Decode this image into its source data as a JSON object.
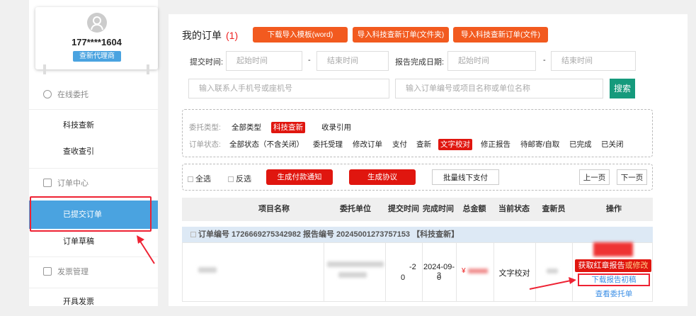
{
  "user": {
    "phone": "177****1604",
    "role": "查新代理商"
  },
  "sidebar": {
    "online": "在线委托",
    "online_items": [
      "科技查新",
      "查收查引"
    ],
    "order_center": "订单中心",
    "submitted": "已提交订单",
    "draft": "订单草稿",
    "invoice": "发票管理",
    "invoice_item": "开具发票"
  },
  "main": {
    "title": "我的订单",
    "count": "(1)",
    "buttons": [
      "下载导入模板(word)",
      "导入科技查新订单(文件夹)",
      "导入科技查新订单(文件)"
    ],
    "submit_time_label": "提交时间:",
    "start_placeholder": "起始时间",
    "end_placeholder": "结束时间",
    "report_date_label": "报告完成日期:",
    "dash": "-",
    "contact_placeholder": "输入联系人手机号或座机号",
    "order_placeholder": "输入订单编号或项目名称或单位名称",
    "search": "搜索",
    "type_label": "委托类型:",
    "types": [
      "全部类型",
      "科技查新",
      "收录引用"
    ],
    "status_label": "订单状态:",
    "statuses": [
      "全部状态（不含关闭）",
      "委托受理",
      "修改订单",
      "支付",
      "查新",
      "文字校对",
      "修正报告",
      "待邮寄/自取",
      "已完成",
      "已关闭"
    ],
    "select_all": "全选",
    "invert": "反选",
    "act_buttons": [
      "生成付款通知",
      "生成协议",
      "批量线下支付"
    ],
    "prev": "上一页",
    "next": "下一页",
    "columns": [
      "项目名称",
      "委托单位",
      "提交时间",
      "完成时间",
      "总金额",
      "当前状态",
      "查新员",
      "操作"
    ],
    "order_header": "订单编号 1726669275342982  报告编号 20245001273757153  【科技查新】",
    "row": {
      "submit_a": "-2",
      "submit_b": "0",
      "finish_a": "2024-09-3",
      "finish_b": "0",
      "currency": "¥",
      "status": "文字校对"
    },
    "ops": {
      "get_red_a": "获取红章报告",
      "get_red_b": "或修改",
      "download": "下载报告初稿",
      "view": "查看委托单"
    }
  }
}
